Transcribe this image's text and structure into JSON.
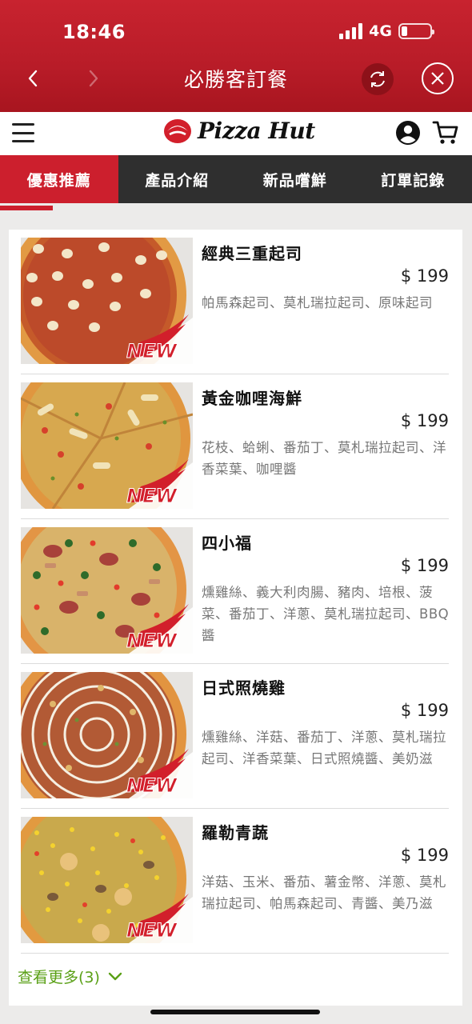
{
  "status_bar": {
    "time": "18:46",
    "network": "4G",
    "battery_level": 0.2
  },
  "webview_nav": {
    "title": "必勝客訂餐",
    "back_icon": "chevron-left-icon",
    "forward_icon": "chevron-right-icon",
    "refresh_icon": "refresh-icon",
    "close_icon": "close-icon"
  },
  "site_header": {
    "logo_text": "Pizza Hut",
    "menu_icon": "hamburger-menu-icon",
    "account_icon": "account-icon",
    "cart_icon": "cart-icon"
  },
  "tabs": [
    {
      "label": "優惠推薦",
      "active": true
    },
    {
      "label": "產品介紹",
      "active": false
    },
    {
      "label": "新品嚐鮮",
      "active": false
    },
    {
      "label": "訂單記錄",
      "active": false
    }
  ],
  "products": [
    {
      "name": "經典三重起司",
      "price": "$ 199",
      "description": "帕馬森起司、莫札瑞拉起司、原味起司",
      "badge": "NEW"
    },
    {
      "name": "黃金咖哩海鮮",
      "price": "$ 199",
      "description": "花枝、蛤蜊、番茄丁、莫札瑞拉起司、洋香菜葉、咖哩醬",
      "badge": "NEW"
    },
    {
      "name": "四小福",
      "price": "$ 199",
      "description": "燻雞絲、義大利肉腸、豬肉、培根、菠菜、番茄丁、洋蔥、莫札瑞拉起司、BBQ醬",
      "badge": "NEW"
    },
    {
      "name": "日式照燒雞",
      "price": "$ 199",
      "description": "燻雞絲、洋菇、番茄丁、洋蔥、莫札瑞拉起司、洋香菜葉、日式照燒醬、美奶滋",
      "badge": "NEW"
    },
    {
      "name": "羅勒青蔬",
      "price": "$ 199",
      "description": "洋菇、玉米、番茄、薯金幣、洋蔥、莫札瑞拉起司、帕馬森起司、青醬、美乃滋",
      "badge": "NEW"
    }
  ],
  "see_more": {
    "label": "查看更多(3)",
    "icon": "chevron-down-icon"
  },
  "colors": {
    "brand_red": "#c8232f",
    "tab_bar": "#2f2f2f",
    "accent_green": "#5aa016"
  }
}
